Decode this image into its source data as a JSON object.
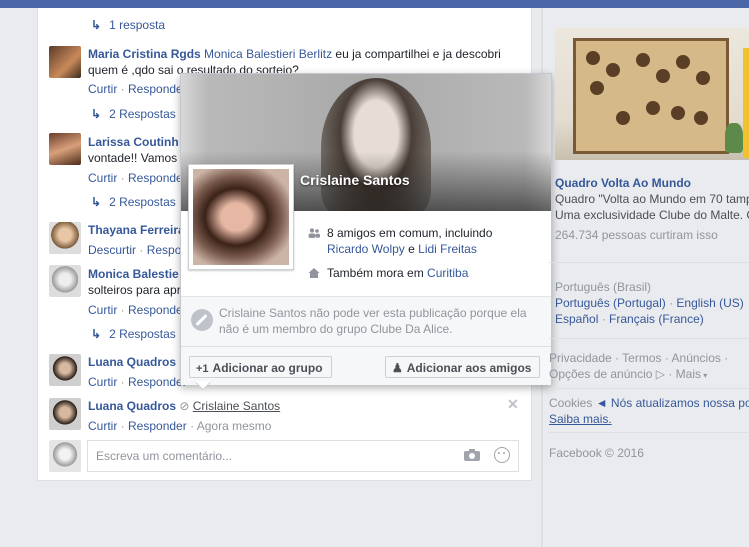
{
  "feed": {
    "reply_arrow": "↳",
    "reply_top": "1 resposta",
    "comments": [
      {
        "name": "Maria Cristina Rgds",
        "mention": "Monica Balestieri Berlitz",
        "text1": " eu ja compartilhei e ja descobri",
        "text2": "quem é ,qdo sai o resultado do sorteio?",
        "like": "Curtir",
        "reply": "Responder",
        "replies": "2 Respostas"
      },
      {
        "name": "Larissa Coutinh",
        "text": "vontade!! Vamos",
        "like": "Curtir",
        "reply": "Responder",
        "replies": "2 Respostas"
      },
      {
        "name": "Thayana Ferreira",
        "like": "Descurtir",
        "reply": "Respo"
      },
      {
        "name": "Monica Balestie",
        "text": "solteiros para apr",
        "like": "Curtir",
        "reply": "Responder",
        "replies": "2 Respostas"
      },
      {
        "name": "Luana Quadros",
        "like": "Curtir",
        "reply": "Responder"
      },
      {
        "name": "Luana Quadros",
        "mention": "Crislaine Santos",
        "like": "Curtir",
        "reply": "Responder",
        "time": "Agora mesmo"
      }
    ],
    "close_glyph": "✕",
    "comment_placeholder": "Escreva um comentário..."
  },
  "popup": {
    "name": "Crislaine Santos",
    "mutual": "8 amigos em comum, incluindo",
    "friend1": "Ricardo Wolpy",
    "and": " e ",
    "friend2": "Lidi Freitas",
    "lives_prefix": "Também mora em ",
    "city": "Curitiba",
    "notice": "Crislaine Santos não pode ver esta publicação porque ela não é um membro do grupo Clube Da Alice.",
    "add_group": "Adicionar ao grupo",
    "add_friends": "Adicionar aos amigos"
  },
  "ad": {
    "title": "Quadro Volta Ao Mundo",
    "desc1": "Quadro \"Volta ao Mundo em 70 tamp",
    "desc2": "Uma exclusividade Clube do Malte. C",
    "likes": "264.734 pessoas curtiram isso"
  },
  "languages": {
    "current": "Português (Brasil)",
    "sep": " · ",
    "l1": "Português (Portugal)",
    "l2": "English (US)",
    "l3": "Español",
    "l4": "Français (France)"
  },
  "footer": {
    "privacy": "Privacidade",
    "terms": "Termos",
    "ads": "Anúncios",
    "ad_choices": "Opções de anúncio",
    "more": "Mais",
    "cookies_label": "Cookies",
    "cookies_text": "◄ Nós atualizamos nossa po",
    "learn_more": "Saiba mais.",
    "copyright": "Facebook © 2016"
  }
}
